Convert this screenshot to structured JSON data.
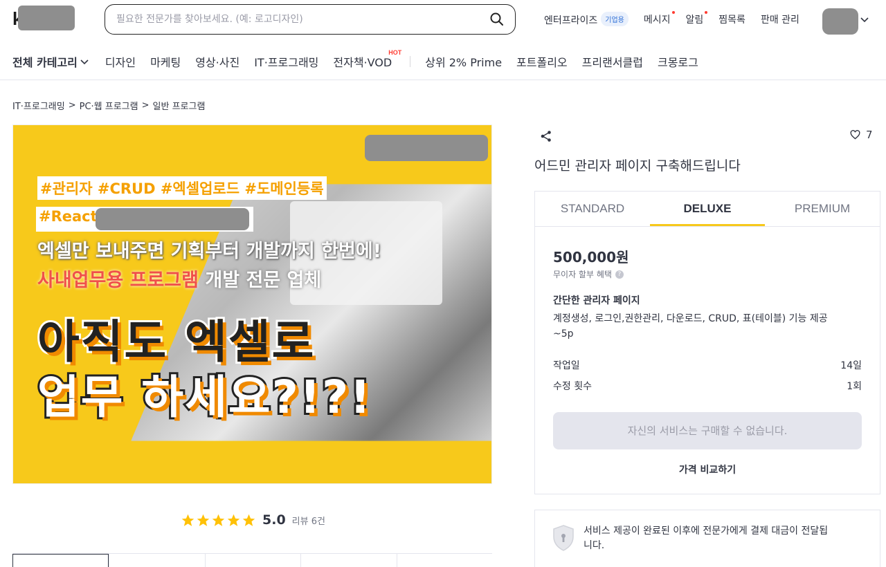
{
  "header": {
    "logo_letter": "k",
    "search_placeholder": "필요한 전문가를 찾아보세요. (예: 로고디자인)",
    "nav": {
      "enterprise": "엔터프라이즈",
      "enterprise_badge": "기업용",
      "messages": "메시지",
      "alerts": "알림",
      "wishlist": "찜목록",
      "seller": "판매 관리"
    }
  },
  "categories": {
    "all": "전체 카테고리",
    "items": [
      "디자인",
      "마케팅",
      "영상·사진",
      "IT·프로그래밍",
      "전자책·VOD"
    ],
    "hot_label": "HOT",
    "extra": [
      "상위 2% Prime",
      "포트폴리오",
      "프리랜서클럽",
      "크몽로그"
    ]
  },
  "breadcrumb": [
    "IT·프로그래밍",
    "PC·웹 프로그램",
    "일반 프로그램"
  ],
  "hero": {
    "tags_line1": "#관리자 #CRUD #엑셀업로드 #도메인등록",
    "tags_line2": "#React",
    "line3": "엑셀만 보내주면 기획부터 개발까지  한번에!",
    "line4_red": "사내업무용 프로그램",
    "line4_white": " 개발 전문 업체",
    "big1": "아직도 엑셀로",
    "big2": "업무 하세요?!?!"
  },
  "rating": {
    "score": "5.0",
    "reviews": "리뷰 6건",
    "stars": 5
  },
  "service": {
    "title": "어드민 관리자 페이지 구축해드립니다",
    "likes": "7"
  },
  "package": {
    "tabs": [
      "STANDARD",
      "DELUXE",
      "PREMIUM"
    ],
    "active_tab": "DELUXE",
    "price": "500,000원",
    "installment": "무이자 할부 혜택",
    "name": "간단한 관리자 페이지",
    "description": "계정생성, 로그인,권한관리,  다운로드, CRUD, 표(테이블) 기능 제공 ~5p",
    "work_days_label": "작업일",
    "work_days_value": "14일",
    "revisions_label": "수정 횟수",
    "revisions_value": "1회",
    "buy_label": "자신의 서비스는 구매할 수 없습니다.",
    "compare_label": "가격 비교하기"
  },
  "notice": {
    "text": "서비스 제공이 완료된 이후에 전문가에게 결제 대금이 전달됩니다."
  },
  "colors": {
    "accent_yellow": "#f7c91b",
    "text_primary": "#303441",
    "text_secondary": "#707482",
    "alert_dot": "#ff3b30",
    "star": "#ffc107"
  }
}
